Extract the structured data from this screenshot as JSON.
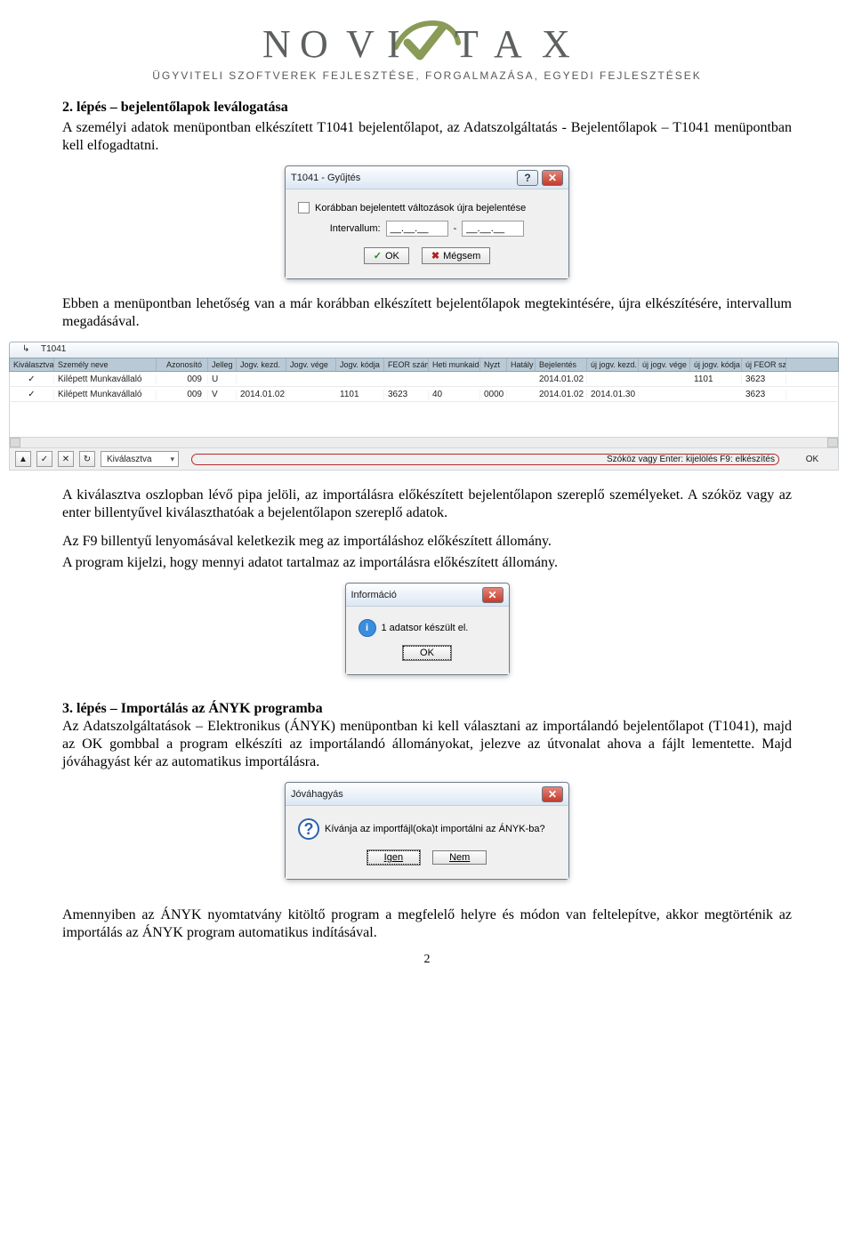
{
  "logo": {
    "word": "NOVITAX",
    "tagline": "Ügyviteli szoftverek fejlesztése, forgalmazása, egyedi fejlesztések"
  },
  "section2": {
    "heading": "2. lépés – bejelentőlapok leválogatása",
    "para1": "A személyi adatok menüpontban elkészített T1041 bejelentőlapot, az Adatszolgáltatás - Bejelentőlapok – T1041 menüpontban kell elfogadtatni.",
    "para2": "Ebben a menüpontban lehetőség van a már korábban elkészített bejelentőlapok megtekintésére, újra elkészítésére, intervallum megadásával."
  },
  "dialog_gyujtes": {
    "title": "T1041 - Gyűjtés",
    "checkbox_label": "Korábban bejelentett változások újra bejelentése",
    "interval_label": "Intervallum:",
    "interval_from": "__.__.__",
    "interval_to": "__.__.__",
    "ok": "OK",
    "cancel": "Mégsem",
    "help_glyph": "?",
    "close_glyph": "✕"
  },
  "grid": {
    "tab": "T1041",
    "headers": [
      "Kiválasztva",
      "Személy neve",
      "Azonosító",
      "Jelleg",
      "Jogv. kezd.",
      "Jogv. vége",
      "Jogv. kódja",
      "FEOR szám",
      "Heti munkaidő",
      "Nyzt",
      "Hatály",
      "Bejelentés",
      "új jogv. kezd.",
      "új jogv. vége",
      "új jogv. kódja",
      "új FEOR szá"
    ],
    "rows": [
      {
        "sel": "✓",
        "name": "Kilépett Munkavállaló",
        "id": "009",
        "jelleg": "U",
        "kezd": "",
        "vege": "",
        "kodja": "",
        "feor": "",
        "heti": "",
        "nyzt": "",
        "hataly": "",
        "bej": "2014.01.02",
        "ujkezd": "",
        "ujvege": "",
        "ujkod": "1101",
        "ujfeor": "3623"
      },
      {
        "sel": "✓",
        "name": "Kilépett Munkavállaló",
        "id": "009",
        "jelleg": "V",
        "kezd": "2014.01.02",
        "vege": "",
        "kodja": "1101",
        "feor": "3623",
        "heti": "40",
        "nyzt": "0000",
        "hataly": "",
        "bej": "2014.01.02",
        "ujkezd": "2014.01.30",
        "ujvege": "",
        "ujkod": "",
        "ujfeor": "3623"
      }
    ],
    "footer": {
      "dropdown_value": "Kiválasztva",
      "hint": "Szóköz vagy Enter: kijelölés   F9: elkészítés",
      "ok": "OK"
    }
  },
  "after_grid": {
    "para1": "A kiválasztva oszlopban lévő pipa jelöli, az importálásra előkészített bejelentőlapon szereplő személyeket. A szóköz vagy az enter billentyűvel kiválaszthatóak a bejelentőlapon szereplő adatok.",
    "para2": "Az F9 billentyű lenyomásával keletkezik meg az importáláshoz előkészített állomány.",
    "para3": "A program kijelzi, hogy mennyi adatot tartalmaz az importálásra előkészített állomány."
  },
  "dialog_info": {
    "title": "Információ",
    "message": "1 adatsor készült el.",
    "ok": "OK",
    "close_glyph": "✕",
    "info_glyph": "i"
  },
  "section3": {
    "heading": "3. lépés – Importálás az ÁNYK programba",
    "para": "Az Adatszolgáltatások – Elektronikus (ÁNYK) menüpontban ki kell választani az importálandó bejelentőlapot (T1041), majd az OK gombbal a program elkészíti az importálandó állományokat, jelezve az útvonalat ahova a fájlt lementette. Majd jóváhagyást kér az automatikus importálásra."
  },
  "dialog_confirm": {
    "title": "Jóváhagyás",
    "message": "Kívánja az importfájl(oka)t importálni az ÁNYK-ba?",
    "yes": "Igen",
    "no": "Nem",
    "close_glyph": "✕"
  },
  "closing_para": "Amennyiben az ÁNYK nyomtatvány kitöltő program a megfelelő helyre és módon van feltelepítve, akkor megtörténik az importálás az ÁNYK program automatikus indításával.",
  "pagenum": "2"
}
